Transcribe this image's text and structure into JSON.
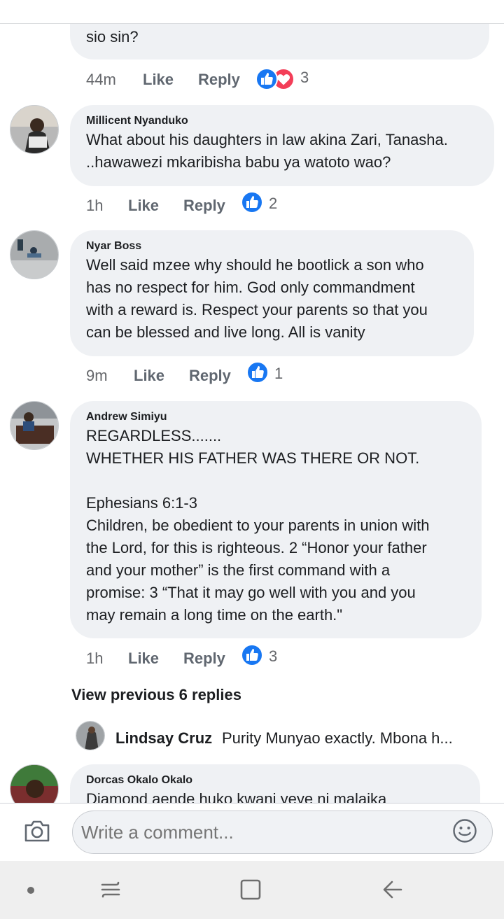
{
  "comments": [
    {
      "text": "sio sin?",
      "time": "44m",
      "like_label": "Like",
      "reply_label": "Reply",
      "reaction_count": "3",
      "reactions": [
        "like-icon",
        "love-icon"
      ]
    },
    {
      "author": "Millicent Nyanduko",
      "text": "What about his daughters in law akina Zari, Tanasha.\n..hawawezi mkaribisha babu ya watoto wao?",
      "time": "1h",
      "like_label": "Like",
      "reply_label": "Reply",
      "reaction_count": "2",
      "reactions": [
        "like-icon"
      ]
    },
    {
      "author": "Nyar Boss",
      "text": "Well said mzee why should he bootlick a son who\nhas no respect for him. God only commandment\nwith a reward is. Respect your parents so that you\ncan be blessed and live long. All is vanity",
      "time": "9m",
      "like_label": "Like",
      "reply_label": "Reply",
      "reaction_count": "1",
      "reactions": [
        "like-icon"
      ]
    },
    {
      "author": "Andrew Simiyu",
      "text": "REGARDLESS.......\nWHETHER HIS FATHER WAS THERE OR NOT.\n\nEphesians 6:1-3\nChildren, be obedient to your parents in union with\nthe Lord, for this is righteous.  2 “Honor your father\nand your mother” is the first command with a\npromise:  3 “That it may go well with you and you\nmay remain a long time on the earth.\"",
      "time": "1h",
      "like_label": "Like",
      "reply_label": "Reply",
      "reaction_count": "3",
      "reactions": [
        "like-icon"
      ]
    },
    {
      "author": "Dorcas Okalo Okalo",
      "text": "Diamond aende huko kwani yeye ni malaika"
    }
  ],
  "view_previous": "View previous 6 replies",
  "reply_preview": {
    "author": "Lindsay Cruz",
    "text": "Purity Munyao exactly. Mbona h..."
  },
  "composer": {
    "placeholder": "Write a comment...",
    "icons": [
      "camera-icon",
      "smiley-icon"
    ]
  },
  "navbar": {
    "icons": [
      "dot-icon",
      "recent-apps-icon",
      "home-icon",
      "back-icon"
    ]
  },
  "colors": {
    "like_blue": "#1877f2",
    "love_red": "#f33e58",
    "bubble_bg": "#eff1f4",
    "meta_gray": "#65676b"
  }
}
